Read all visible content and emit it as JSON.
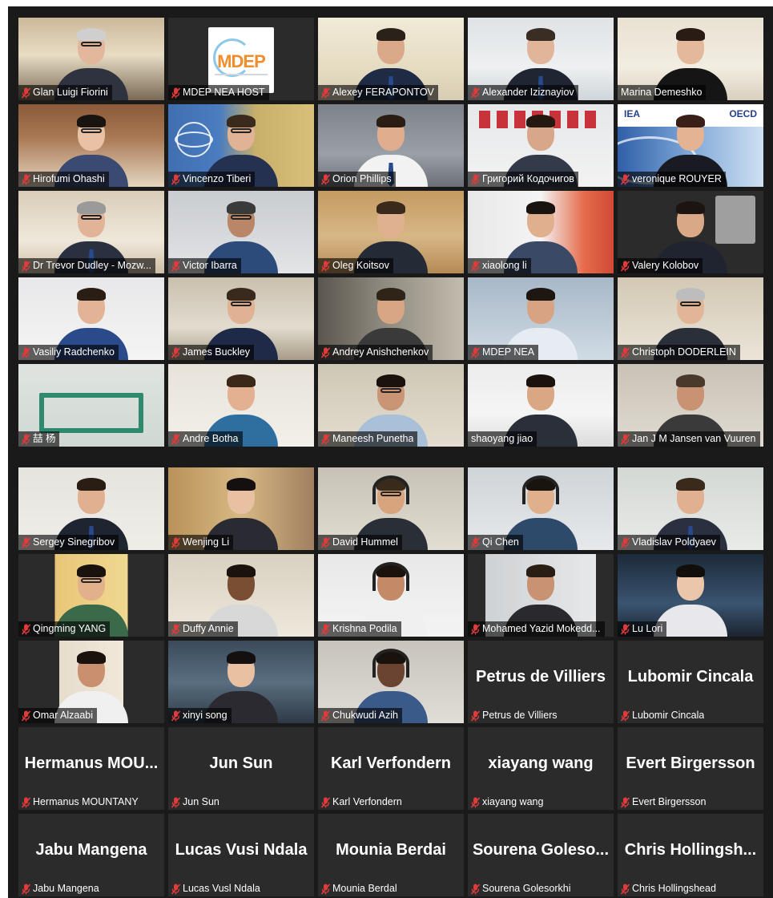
{
  "colors": {
    "background": "#1a1a1a",
    "tile": "#2b2b2b",
    "active_speaker_outline": "#cfe64a",
    "muted_icon": "#e03b3b"
  },
  "icons": {
    "muted": "microphone-muted-icon"
  },
  "top_grid": [
    {
      "name": "Glan Luigi Fiorini",
      "muted": true
    },
    {
      "name": "MDEP NEA HOST",
      "muted": true,
      "logo_text": "MDEP"
    },
    {
      "name": "Alexey FERAPONTOV",
      "muted": true
    },
    {
      "name": "Alexander Iziznayiov",
      "muted": true
    },
    {
      "name": "Marina Demeshko",
      "muted": false,
      "active_speaker": true
    },
    {
      "name": "Hirofumi Ohashi",
      "muted": true
    },
    {
      "name": "Vincenzo Tiberi",
      "muted": true
    },
    {
      "name": "Orion Phillips",
      "muted": true
    },
    {
      "name": "Григорий Кодочигов",
      "muted": true
    },
    {
      "name": "veronique ROUYER",
      "muted": true,
      "banner_left": "IEA",
      "banner_right": "OECD"
    },
    {
      "name": "Dr Trevor Dudley - Mozw...",
      "muted": true
    },
    {
      "name": "Victor Ibarra",
      "muted": true
    },
    {
      "name": "Oleg Koitsov",
      "muted": true
    },
    {
      "name": "xiaolong li",
      "muted": true
    },
    {
      "name": "Valery Kolobov",
      "muted": true
    },
    {
      "name": "Vasiliy Radchenko",
      "muted": true
    },
    {
      "name": "James Buckley",
      "muted": true
    },
    {
      "name": "Andrey Anishchenkov",
      "muted": true
    },
    {
      "name": "MDEP NEA",
      "muted": true
    },
    {
      "name": "Christoph DODERLEIN",
      "muted": true
    },
    {
      "name": "喆 杨",
      "muted": true
    },
    {
      "name": "Andre Botha",
      "muted": true
    },
    {
      "name": "Maneesh Punetha",
      "muted": true
    },
    {
      "name": "shaoyang jiao",
      "muted": false
    },
    {
      "name": "Jan J M Jansen van Vuuren",
      "muted": true
    }
  ],
  "bottom_grid": [
    {
      "name": "Sergey Sinegribov",
      "muted": true
    },
    {
      "name": "Wenjing Li",
      "muted": true
    },
    {
      "name": "David Hummel",
      "muted": true
    },
    {
      "name": "Qi Chen",
      "muted": true
    },
    {
      "name": "Vladislav Poldyaev",
      "muted": true
    },
    {
      "name": "Qingming YANG",
      "muted": true
    },
    {
      "name": "Duffy Annie",
      "muted": true
    },
    {
      "name": "Krishna Podila",
      "muted": true
    },
    {
      "name": "Mohamed Yazid Mokedd...",
      "muted": true
    },
    {
      "name": "Lu Lori",
      "muted": true
    },
    {
      "name": "Omar Alzaabi",
      "muted": true
    },
    {
      "name": "xinyi song",
      "muted": true
    },
    {
      "name": "Chukwudi Azih",
      "muted": true
    },
    {
      "name": "Petrus de Villiers",
      "muted": true,
      "display": "Petrus de Villiers"
    },
    {
      "name": "Lubomir Cincala",
      "muted": true,
      "display": "Lubomir Cincala"
    },
    {
      "name": "Hermanus MOUNTANY",
      "muted": true,
      "display": "Hermanus  MOU..."
    },
    {
      "name": "Jun Sun",
      "muted": true,
      "display": "Jun Sun"
    },
    {
      "name": "Karl Verfondern",
      "muted": true,
      "display": "Karl Verfondern"
    },
    {
      "name": "xiayang wang",
      "muted": true,
      "display": "xiayang wang"
    },
    {
      "name": "Evert Birgersson",
      "muted": true,
      "display": "Evert Birgersson"
    },
    {
      "name": "Jabu Mangena",
      "muted": true,
      "display": "Jabu Mangena"
    },
    {
      "name": "Lucas Vusl Ndala",
      "muted": true,
      "display": "Lucas Vusi Ndala"
    },
    {
      "name": "Mounia Berdal",
      "muted": true,
      "display": "Mounia Berdai"
    },
    {
      "name": "Sourena Golesorkhi",
      "muted": true,
      "display": "Sourena  Goleso..."
    },
    {
      "name": "Chris Hollingshead",
      "muted": true,
      "display": "Chris  Hollingsh..."
    }
  ]
}
